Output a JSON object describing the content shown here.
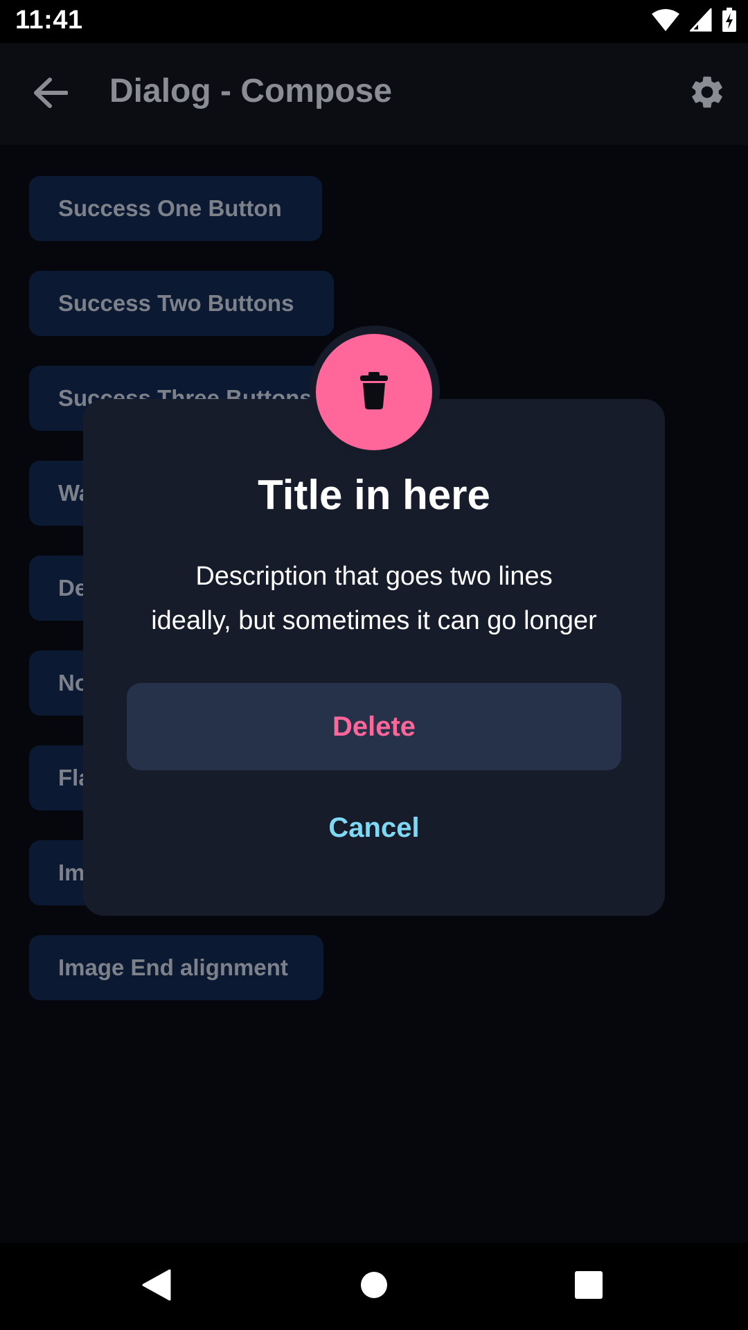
{
  "status_bar": {
    "time": "11:41",
    "icons": [
      "wifi-icon",
      "cellular-signal-icon",
      "battery-charging-icon"
    ]
  },
  "app_bar": {
    "back_icon": "arrow-left-icon",
    "title": "Dialog - Compose",
    "settings_icon": "gear-icon"
  },
  "list": {
    "buttons": [
      {
        "label": "Success One Button"
      },
      {
        "label": "Success Two Buttons"
      },
      {
        "label": "Success Three Buttons"
      },
      {
        "label": "Wa"
      },
      {
        "label": "De"
      },
      {
        "label": "No"
      },
      {
        "label": "Fla"
      },
      {
        "label": "Im"
      },
      {
        "label": "Image End alignment"
      }
    ]
  },
  "dialog": {
    "icon": "trash-icon",
    "title": "Title in here",
    "description_line1": "Description that goes two lines",
    "description_line2": "ideally, but sometimes it can go longer",
    "primary_label": "Delete",
    "secondary_label": "Cancel"
  },
  "nav_bar": {
    "back_icon": "triangle-back-icon",
    "home_icon": "circle-home-icon",
    "recents_icon": "square-recents-icon"
  },
  "colors": {
    "background": "#05070C",
    "app_bar": "#0B0D12",
    "list_button": "#0B1A32",
    "dialog": "#161C29",
    "accent_pink": "#FF6699",
    "cancel_cyan": "#7FD9F5",
    "delete_button_bg": "#253249"
  }
}
